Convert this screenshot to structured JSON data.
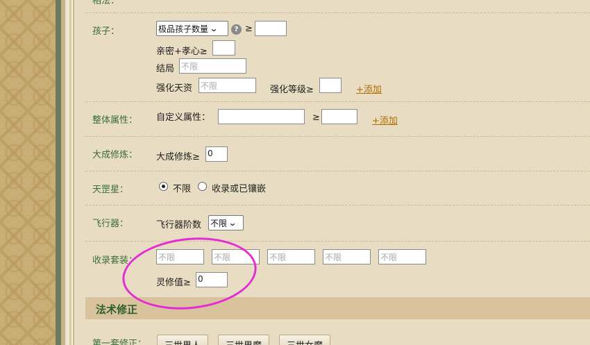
{
  "rows": {
    "top_cut_label": "相法：",
    "child": {
      "label": "孩子：",
      "select_value": "极品孩子数量",
      "help": "?",
      "ge": "≥",
      "count_value": "",
      "intimacy_label": "亲密+孝心≥",
      "intimacy_value": "",
      "ending_label": "结局",
      "ending_placeholder": "不限",
      "talent_label": "强化天资",
      "talent_placeholder": "不限",
      "level_label": "强化等级≥",
      "level_value": "",
      "add": "+添加"
    },
    "overall": {
      "label": "整体属性：",
      "custom_label": "自定义属性：",
      "ge": "≥",
      "add": "+添加"
    },
    "dacheng": {
      "label": "大成修炼：",
      "field_label": "大成修炼≥",
      "value": "0"
    },
    "tiangang": {
      "label": "天罡星：",
      "opt1": "不限",
      "opt2": "收录或已镶嵌"
    },
    "aircraft": {
      "label": "飞行器：",
      "field_label": "飞行器阶数",
      "select_value": "不限"
    },
    "suit": {
      "label": "收录套装：",
      "placeholders": [
        "不限",
        "不限",
        "不限",
        "不限",
        "不限"
      ],
      "lingxiu_label": "灵修值≥",
      "lingxiu_value": "0"
    }
  },
  "section": {
    "title": "法术修正"
  },
  "first_fix": {
    "label": "第一套修正：",
    "buttons": [
      "三世男人",
      "三世男魔",
      "三世女魔"
    ]
  },
  "colors": {
    "label_green": "#3a6e3a",
    "link_orange": "#b36b00",
    "annotation_magenta": "#e62ad8",
    "background": "#e8dcc3"
  }
}
